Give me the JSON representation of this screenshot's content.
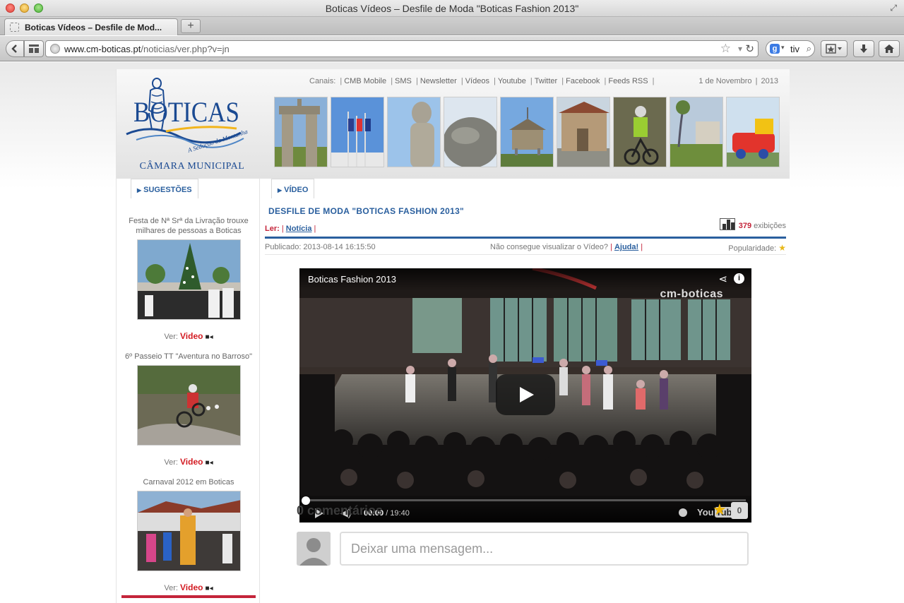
{
  "window": {
    "title": "Boticas Vídeos – Desfile de Moda \"Boticas Fashion 2013\"",
    "tab_label": "Boticas Vídeos – Desfile de Mod...",
    "new_tab": "+"
  },
  "toolbar": {
    "url_domain": "www.cm-boticas.pt",
    "url_path": "/noticias/ver.php?v=jn",
    "search_value": "tiv"
  },
  "header": {
    "logo_text": "BOTICAS",
    "logo_tagline": "A Sedução da Montanha",
    "logo_caption": "CÂMARA MUNICIPAL",
    "channels_label": "Canais:",
    "channels": [
      "CMB Mobile",
      "SMS",
      "Newsletter",
      "Vídeos",
      "Youtube",
      "Twitter",
      "Facebook",
      "Feeds RSS"
    ],
    "date_day": "1 de Novembro",
    "date_year": "2013"
  },
  "sidebar": {
    "tab_label": "SUGESTÕES",
    "ver_label": "Ver:",
    "video_label": "Video",
    "items": [
      {
        "title": "Festa de Nª Srª da Livração trouxe milhares de pessoas a Boticas"
      },
      {
        "title": "6º Passeio TT \"Aventura no Barroso\""
      },
      {
        "title": "Carnaval 2012 em Boticas"
      }
    ]
  },
  "main": {
    "tab_label": "VÍDEO",
    "title": "DESFILE DE MODA \"BOTICAS FASHION 2013\"",
    "read_label": "Ler:",
    "read_link": "Notícia",
    "views_count": "379",
    "views_label": "exibições",
    "published": "Publicado: 2013-08-14 16:15:50",
    "help_text": "Não consegue visualizar o Vídeo?",
    "help_link": "Ajuda!",
    "popularity_label": "Popularidade:",
    "player": {
      "title": "Boticas Fashion 2013",
      "watermark": "cm-boticas",
      "time_current": "00:00",
      "time_total": "/ 19:40",
      "progress": 0,
      "brand": "You",
      "brand_box": "Tube"
    },
    "comments": {
      "count_label": "0 comentários",
      "star_count": "0",
      "input_placeholder": "Deixar uma mensagem..."
    }
  },
  "colors": {
    "link_blue": "#2a5f9e",
    "accent_red": "#c4243a",
    "logo_blue": "#1b4a92"
  }
}
